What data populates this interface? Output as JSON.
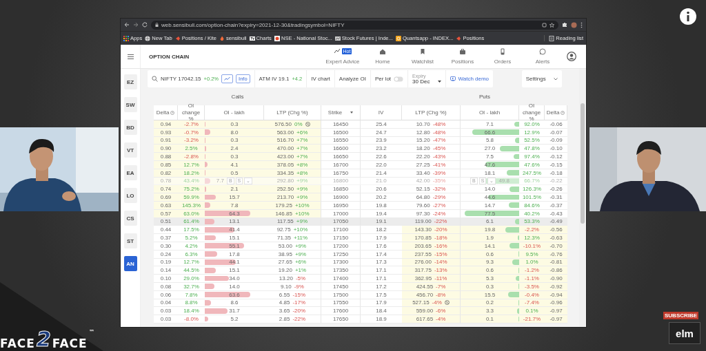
{
  "browser": {
    "url": "web.sensibull.com/option-chain?expiry=2021-12-30&tradingsymbol=NIFTY",
    "bookmarks": [
      "Apps",
      "New Tab",
      "Positions / Kite",
      "sensibull",
      "Charts",
      "NSE - National Stoc...",
      "Stock Futures | Inde...",
      "Quantsapp - INDEX...",
      "Positions"
    ],
    "reading_list": "Reading list"
  },
  "app": {
    "title": "OPTION CHAIN",
    "nav": [
      {
        "label": "Expert Advice",
        "badge": "Hot"
      },
      {
        "label": "Home"
      },
      {
        "label": "Watchlist"
      },
      {
        "label": "Positions"
      },
      {
        "label": "Orders"
      },
      {
        "label": "Alerts"
      }
    ],
    "sidebar": [
      {
        "label": "EZ",
        "selected": false
      },
      {
        "label": "SW",
        "selected": false
      },
      {
        "label": "BD",
        "selected": false
      },
      {
        "label": "VT",
        "selected": false
      },
      {
        "label": "EA",
        "selected": false
      },
      {
        "label": "LO",
        "selected": false
      },
      {
        "label": "CS",
        "selected": false
      },
      {
        "label": "ST",
        "selected": false
      },
      {
        "label": "AN",
        "selected": true
      }
    ],
    "toolbar": {
      "symbol": "NIFTY 17042.15",
      "symbol_change": "+0.2%",
      "info": "Info",
      "atm_iv": "ATM IV 19.1",
      "atm_iv_change": "+4.2",
      "iv_chart": "IV chart",
      "analyze_oi": "Analyze OI",
      "per_lot": {
        "label": "Per lot",
        "on": false
      },
      "expiry": {
        "label": "Expiry",
        "value": "30 Dec"
      },
      "watch_demo": "Watch demo",
      "settings": "Settings"
    },
    "table": {
      "calls_title": "Calls",
      "puts_title": "Puts",
      "columns": [
        "Delta",
        "OI change %",
        "OI - lakh",
        "LTP (Chg %)",
        "Strike",
        "IV",
        "LTP (Chg %)",
        "OI - lakh",
        "OI change %",
        "Delta"
      ],
      "rows": [
        {
          "strike": "16450",
          "iv": "25.4",
          "atm": false,
          "hovered": false,
          "call": {
            "itm": true,
            "delta": "0.94",
            "oi_change": "-2.7%",
            "oi": "0.3",
            "level": 0.004,
            "ltp": "576.50",
            "chg": "0%",
            "note": true
          },
          "put": {
            "itm": false,
            "delta": "-0.06",
            "oi_change": "92.0%",
            "oi": "7.1",
            "level": 0.085,
            "ltp": "10.70",
            "chg": "-48%",
            "note": false
          }
        },
        {
          "strike": "16500",
          "iv": "24.7",
          "atm": false,
          "hovered": false,
          "call": {
            "itm": true,
            "delta": "0.93",
            "oi_change": "-0.7%",
            "oi": "8.0",
            "level": 0.096,
            "ltp": "563.00",
            "chg": "+6%",
            "note": false
          },
          "put": {
            "itm": false,
            "delta": "-0.07",
            "oi_change": "12.9%",
            "oi": "66.6",
            "level": 0.799,
            "ltp": "12.80",
            "chg": "-48%",
            "note": false
          }
        },
        {
          "strike": "16550",
          "iv": "23.9",
          "atm": false,
          "hovered": false,
          "call": {
            "itm": true,
            "delta": "0.91",
            "oi_change": "-3.2%",
            "oi": "0.3",
            "level": 0.004,
            "ltp": "516.70",
            "chg": "+7%",
            "note": false
          },
          "put": {
            "itm": false,
            "delta": "-0.09",
            "oi_change": "52.5%",
            "oi": "5.8",
            "level": 0.07,
            "ltp": "15.20",
            "chg": "-47%",
            "note": false
          }
        },
        {
          "strike": "16600",
          "iv": "23.2",
          "atm": false,
          "hovered": false,
          "call": {
            "itm": true,
            "delta": "0.90",
            "oi_change": "2.5%",
            "oi": "2.4",
            "level": 0.029,
            "ltp": "470.00",
            "chg": "+7%",
            "note": false
          },
          "put": {
            "itm": false,
            "delta": "-0.10",
            "oi_change": "47.8%",
            "oi": "27.0",
            "level": 0.324,
            "ltp": "18.20",
            "chg": "-45%",
            "note": false
          }
        },
        {
          "strike": "16650",
          "iv": "22.6",
          "atm": false,
          "hovered": false,
          "call": {
            "itm": true,
            "delta": "0.88",
            "oi_change": "-2.8%",
            "oi": "0.3",
            "level": 0.004,
            "ltp": "423.00",
            "chg": "+7%",
            "note": false
          },
          "put": {
            "itm": false,
            "delta": "-0.12",
            "oi_change": "97.4%",
            "oi": "7.5",
            "level": 0.09,
            "ltp": "22.20",
            "chg": "-43%",
            "note": false
          }
        },
        {
          "strike": "16700",
          "iv": "22.0",
          "atm": false,
          "hovered": false,
          "call": {
            "itm": true,
            "delta": "0.85",
            "oi_change": "12.7%",
            "oi": "4.1",
            "level": 0.049,
            "ltp": "378.05",
            "chg": "+8%",
            "note": false
          },
          "put": {
            "itm": false,
            "delta": "-0.15",
            "oi_change": "47.6%",
            "oi": "47.6",
            "level": 0.571,
            "ltp": "27.25",
            "chg": "-41%",
            "note": false
          }
        },
        {
          "strike": "16750",
          "iv": "21.4",
          "atm": false,
          "hovered": false,
          "call": {
            "itm": true,
            "delta": "0.82",
            "oi_change": "18.2%",
            "oi": "0.5",
            "level": 0.006,
            "ltp": "334.35",
            "chg": "+8%",
            "note": false
          },
          "put": {
            "itm": false,
            "delta": "-0.18",
            "oi_change": "247.5%",
            "oi": "18.1",
            "level": 0.217,
            "ltp": "33.40",
            "chg": "-39%",
            "note": false
          }
        },
        {
          "strike": "16800",
          "iv": "21.0",
          "atm": false,
          "hovered": true,
          "call": {
            "itm": true,
            "delta": "0.78",
            "oi_change": "43.4%",
            "oi": "7.7",
            "level": 0.092,
            "ltp": "292.80",
            "chg": "+9%",
            "note": false,
            "actions": [
              "B",
              "S",
              "⌄"
            ]
          },
          "put": {
            "itm": false,
            "delta": "-0.22",
            "oi_change": "66.7%",
            "oi": "49.8",
            "level": 0.598,
            "ltp": "42.00",
            "chg": "-35%",
            "note": false,
            "actions": [
              "B",
              "S",
              "⌄"
            ]
          }
        },
        {
          "strike": "16850",
          "iv": "20.6",
          "atm": false,
          "hovered": false,
          "call": {
            "itm": true,
            "delta": "0.74",
            "oi_change": "75.2%",
            "oi": "2.1",
            "level": 0.025,
            "ltp": "252.50",
            "chg": "+9%",
            "note": false
          },
          "put": {
            "itm": false,
            "delta": "-0.26",
            "oi_change": "126.3%",
            "oi": "14.0",
            "level": 0.168,
            "ltp": "52.15",
            "chg": "-32%",
            "note": false
          }
        },
        {
          "strike": "16900",
          "iv": "20.2",
          "atm": false,
          "hovered": false,
          "call": {
            "itm": true,
            "delta": "0.69",
            "oi_change": "59.9%",
            "oi": "15.7",
            "level": 0.188,
            "ltp": "213.70",
            "chg": "+9%",
            "note": false
          },
          "put": {
            "itm": false,
            "delta": "-0.31",
            "oi_change": "101.5%",
            "oi": "44.6",
            "level": 0.535,
            "ltp": "64.80",
            "chg": "-29%",
            "note": false
          }
        },
        {
          "strike": "16950",
          "iv": "19.8",
          "atm": false,
          "hovered": false,
          "call": {
            "itm": true,
            "delta": "0.63",
            "oi_change": "145.3%",
            "oi": "7.8",
            "level": 0.094,
            "ltp": "179.25",
            "chg": "+10%",
            "note": false
          },
          "put": {
            "itm": false,
            "delta": "-0.37",
            "oi_change": "84.6%",
            "oi": "14.7",
            "level": 0.176,
            "ltp": "79.60",
            "chg": "-27%",
            "note": false
          }
        },
        {
          "strike": "17000",
          "iv": "19.4",
          "atm": false,
          "hovered": false,
          "call": {
            "itm": true,
            "delta": "0.57",
            "oi_change": "63.0%",
            "oi": "64.3",
            "level": 0.772,
            "ltp": "146.85",
            "chg": "+10%",
            "note": false
          },
          "put": {
            "itm": false,
            "delta": "-0.43",
            "oi_change": "40.2%",
            "oi": "77.5",
            "level": 0.93,
            "ltp": "97.30",
            "chg": "-24%",
            "note": false
          }
        },
        {
          "strike": "17050",
          "iv": "19.1",
          "atm": true,
          "hovered": false,
          "call": {
            "itm": false,
            "delta": "0.51",
            "oi_change": "61.4%",
            "oi": "13.1",
            "level": 0.157,
            "ltp": "117.55",
            "chg": "+9%",
            "note": false
          },
          "put": {
            "itm": false,
            "delta": "-0.49",
            "oi_change": "53.3%",
            "oi": "6.1",
            "level": 0.073,
            "ltp": "119.00",
            "chg": "-22%",
            "note": false
          }
        },
        {
          "strike": "17100",
          "iv": "18.2",
          "atm": false,
          "hovered": false,
          "call": {
            "itm": false,
            "delta": "0.44",
            "oi_change": "17.5%",
            "oi": "41.4",
            "level": 0.497,
            "ltp": "92.75",
            "chg": "+10%",
            "note": false
          },
          "put": {
            "itm": true,
            "delta": "-0.56",
            "oi_change": "-2.2%",
            "oi": "19.8",
            "level": 0.238,
            "ltp": "143.30",
            "chg": "-20%",
            "note": false
          }
        },
        {
          "strike": "17150",
          "iv": "17.9",
          "atm": false,
          "hovered": false,
          "call": {
            "itm": false,
            "delta": "0.37",
            "oi_change": "5.2%",
            "oi": "15.1",
            "level": 0.181,
            "ltp": "71.35",
            "chg": "+11%",
            "note": false
          },
          "put": {
            "itm": true,
            "delta": "-0.63",
            "oi_change": "12.3%",
            "oi": "1.9",
            "level": 0.023,
            "ltp": "170.85",
            "chg": "-18%",
            "note": false
          }
        },
        {
          "strike": "17200",
          "iv": "17.6",
          "atm": false,
          "hovered": false,
          "call": {
            "itm": false,
            "delta": "0.30",
            "oi_change": "4.2%",
            "oi": "55.1",
            "level": 0.661,
            "ltp": "53.00",
            "chg": "+9%",
            "note": false
          },
          "put": {
            "itm": true,
            "delta": "-0.70",
            "oi_change": "-10.1%",
            "oi": "14.1",
            "level": 0.169,
            "ltp": "203.65",
            "chg": "-16%",
            "note": false
          }
        },
        {
          "strike": "17250",
          "iv": "17.4",
          "atm": false,
          "hovered": false,
          "call": {
            "itm": false,
            "delta": "0.24",
            "oi_change": "6.3%",
            "oi": "17.8",
            "level": 0.214,
            "ltp": "38.95",
            "chg": "+9%",
            "note": false
          },
          "put": {
            "itm": true,
            "delta": "-0.76",
            "oi_change": "9.5%",
            "oi": "0.6",
            "level": 0.007,
            "ltp": "237.55",
            "chg": "-15%",
            "note": false
          }
        },
        {
          "strike": "17300",
          "iv": "17.3",
          "atm": false,
          "hovered": false,
          "call": {
            "itm": false,
            "delta": "0.19",
            "oi_change": "12.7%",
            "oi": "44.1",
            "level": 0.529,
            "ltp": "27.65",
            "chg": "+6%",
            "note": false
          },
          "put": {
            "itm": true,
            "delta": "-0.81",
            "oi_change": "1.0%",
            "oi": "9.3",
            "level": 0.112,
            "ltp": "276.00",
            "chg": "-14%",
            "note": false
          }
        },
        {
          "strike": "17350",
          "iv": "17.1",
          "atm": false,
          "hovered": false,
          "call": {
            "itm": false,
            "delta": "0.14",
            "oi_change": "44.5%",
            "oi": "15.1",
            "level": 0.181,
            "ltp": "19.20",
            "chg": "+1%",
            "note": false
          },
          "put": {
            "itm": true,
            "delta": "-0.86",
            "oi_change": "-1.2%",
            "oi": "0.6",
            "level": 0.007,
            "ltp": "317.75",
            "chg": "-13%",
            "note": false
          }
        },
        {
          "strike": "17400",
          "iv": "17.1",
          "atm": false,
          "hovered": false,
          "call": {
            "itm": false,
            "delta": "0.10",
            "oi_change": "29.0%",
            "oi": "34.0",
            "level": 0.408,
            "ltp": "13.20",
            "chg": "-5%",
            "note": false
          },
          "put": {
            "itm": true,
            "delta": "-0.90",
            "oi_change": "-1.1%",
            "oi": "5.3",
            "level": 0.064,
            "ltp": "362.95",
            "chg": "-11%",
            "note": false
          }
        },
        {
          "strike": "17450",
          "iv": "17.2",
          "atm": false,
          "hovered": false,
          "call": {
            "itm": false,
            "delta": "0.08",
            "oi_change": "32.7%",
            "oi": "14.0",
            "level": 0.168,
            "ltp": "9.10",
            "chg": "-9%",
            "note": false
          },
          "put": {
            "itm": true,
            "delta": "-0.92",
            "oi_change": "-3.5%",
            "oi": "0.3",
            "level": 0.004,
            "ltp": "424.55",
            "chg": "-7%",
            "note": false
          }
        },
        {
          "strike": "17500",
          "iv": "17.5",
          "atm": false,
          "hovered": false,
          "call": {
            "itm": false,
            "delta": "0.06",
            "oi_change": "7.8%",
            "oi": "63.6",
            "level": 0.763,
            "ltp": "6.55",
            "chg": "-15%",
            "note": false
          },
          "put": {
            "itm": true,
            "delta": "-0.94",
            "oi_change": "-0.4%",
            "oi": "15.5",
            "level": 0.186,
            "ltp": "456.70",
            "chg": "-8%",
            "note": false
          }
        },
        {
          "strike": "17550",
          "iv": "17.9",
          "atm": false,
          "hovered": false,
          "call": {
            "itm": false,
            "delta": "0.04",
            "oi_change": "8.8%",
            "oi": "8.6",
            "level": 0.103,
            "ltp": "4.85",
            "chg": "-17%",
            "note": false
          },
          "put": {
            "itm": true,
            "delta": "-0.96",
            "oi_change": "-7.4%",
            "oi": "0.2",
            "level": 0.002,
            "ltp": "527.15",
            "chg": "-4%",
            "note": true
          }
        },
        {
          "strike": "17600",
          "iv": "18.4",
          "atm": false,
          "hovered": false,
          "call": {
            "itm": false,
            "delta": "0.03",
            "oi_change": "18.4%",
            "oi": "31.7",
            "level": 0.38,
            "ltp": "3.65",
            "chg": "-20%",
            "note": false
          },
          "put": {
            "itm": true,
            "delta": "-0.97",
            "oi_change": "0.1%",
            "oi": "3.3",
            "level": 0.04,
            "ltp": "559.00",
            "chg": "-6%",
            "note": false
          }
        },
        {
          "strike": "17650",
          "iv": "18.9",
          "atm": false,
          "hovered": false,
          "call": {
            "itm": false,
            "delta": "0.03",
            "oi_change": "-8.0%",
            "oi": "5.2",
            "level": 0.062,
            "ltp": "2.85",
            "chg": "-22%",
            "note": false
          },
          "put": {
            "itm": true,
            "delta": "-0.97",
            "oi_change": "-21.7%",
            "oi": "0.1",
            "level": 0.001,
            "ltp": "617.65",
            "chg": "-4%",
            "note": false
          }
        }
      ]
    }
  },
  "video": {
    "logo": [
      "FACE",
      "2",
      "FACE"
    ],
    "trademark": "™",
    "subscribe": "SUBSCRIBE",
    "channel_logo": "elm"
  }
}
